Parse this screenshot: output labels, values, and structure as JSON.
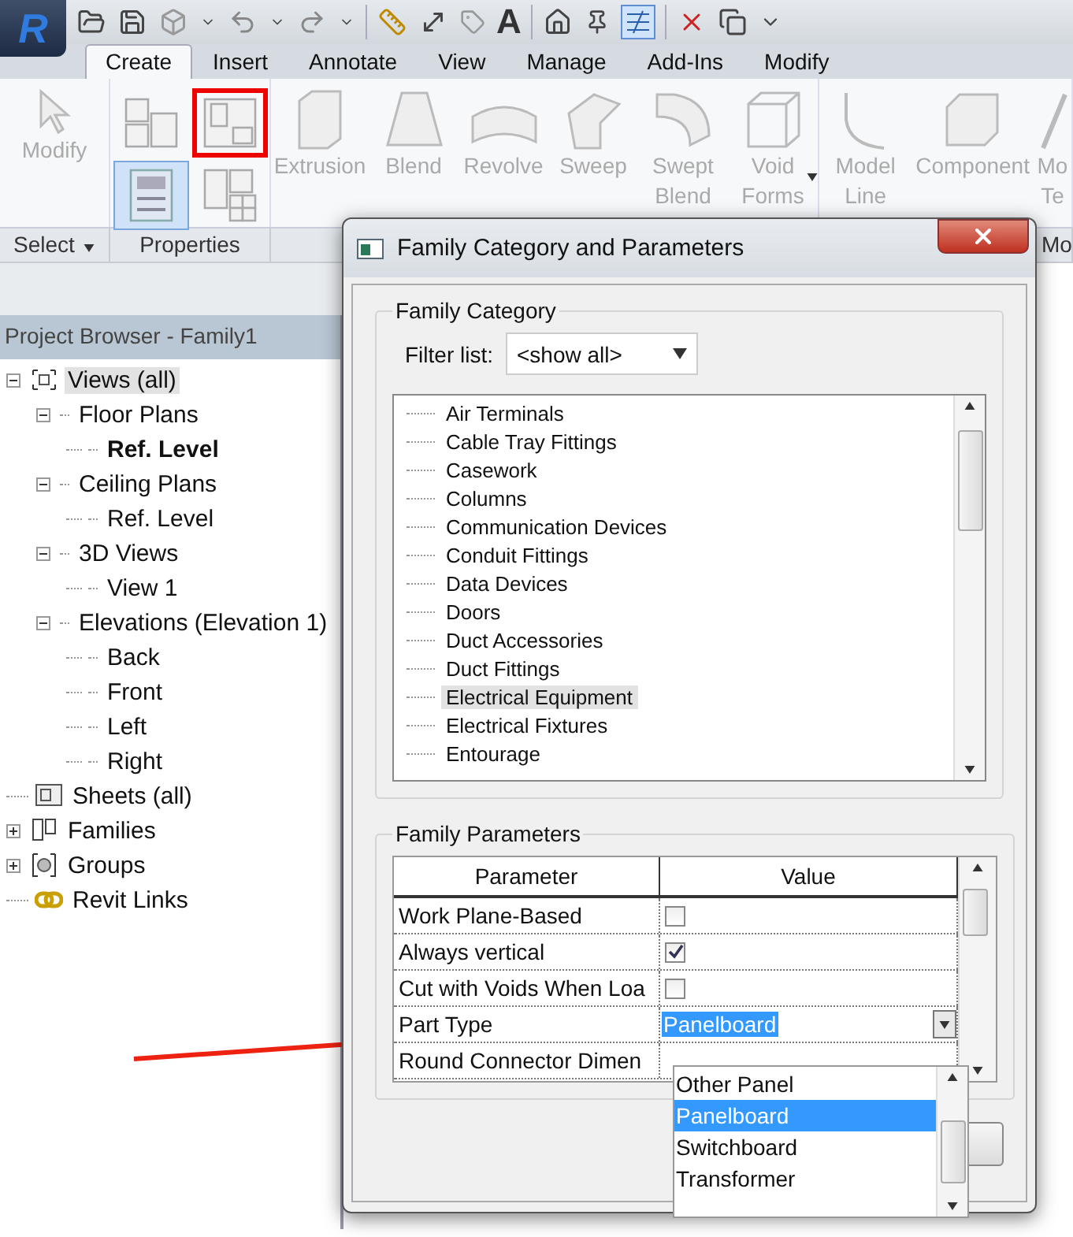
{
  "app_button": {
    "label": "R"
  },
  "quick_access": {
    "text_tool": "A"
  },
  "ribbon_tabs": [
    {
      "label": "Create",
      "selected": true
    },
    {
      "label": "Insert",
      "selected": false
    },
    {
      "label": "Annotate",
      "selected": false
    },
    {
      "label": "View",
      "selected": false
    },
    {
      "label": "Manage",
      "selected": false
    },
    {
      "label": "Add-Ins",
      "selected": false
    },
    {
      "label": "Modify",
      "selected": false
    }
  ],
  "ribbon_panels": [
    {
      "title": "Select",
      "dropdown": true,
      "items": [
        {
          "kind": "cursor",
          "lines": [
            "Modify"
          ]
        }
      ]
    },
    {
      "title": "Properties",
      "small_buttons": [
        {
          "kind": "types",
          "selected": false,
          "annotated": false
        },
        {
          "kind": "category",
          "selected": false,
          "annotated": true
        },
        {
          "kind": "properties",
          "selected": true,
          "annotated": false
        },
        {
          "kind": "grid",
          "selected": false,
          "annotated": false
        }
      ]
    },
    {
      "items": [
        {
          "kind": "extrusion",
          "lines": [
            "Extrusion"
          ]
        },
        {
          "kind": "blend",
          "lines": [
            "Blend"
          ]
        },
        {
          "kind": "revolve",
          "lines": [
            "Revolve"
          ]
        },
        {
          "kind": "sweep",
          "lines": [
            "Sweep"
          ]
        },
        {
          "kind": "swept",
          "lines": [
            "Swept",
            "Blend"
          ]
        },
        {
          "kind": "void",
          "lines": [
            "Void",
            "Forms"
          ],
          "dropdown": true
        }
      ]
    },
    {
      "title": "Mo",
      "items": [
        {
          "kind": "line",
          "lines": [
            "Model",
            "Line"
          ]
        },
        {
          "kind": "component",
          "lines": [
            "Component"
          ]
        },
        {
          "kind": "text",
          "lines": [
            "Mo",
            "Te"
          ]
        }
      ]
    }
  ],
  "project_browser": {
    "title": "Project Browser - Family1",
    "tree": [
      {
        "label": "Views (all)",
        "kind": "views",
        "expanded": true,
        "selected": true,
        "children": [
          {
            "label": "Floor Plans",
            "expanded": true,
            "selected": false,
            "children": [
              {
                "label": "Ref. Level",
                "active": true,
                "selected": false
              }
            ]
          },
          {
            "label": "Ceiling Plans",
            "expanded": true,
            "selected": false,
            "children": [
              {
                "label": "Ref. Level",
                "active": false,
                "selected": false
              }
            ]
          },
          {
            "label": "3D Views",
            "expanded": true,
            "selected": false,
            "children": [
              {
                "label": "View 1",
                "active": false,
                "selected": false
              }
            ]
          },
          {
            "label": "Elevations (Elevation 1)",
            "expanded": true,
            "selected": false,
            "children": [
              {
                "label": "Back",
                "active": false,
                "selected": false
              },
              {
                "label": "Front",
                "active": false,
                "selected": false
              },
              {
                "label": "Left",
                "active": false,
                "selected": false
              },
              {
                "label": "Right",
                "active": false,
                "selected": false
              }
            ]
          }
        ]
      },
      {
        "label": "Sheets (all)",
        "kind": "sheets",
        "selected": false
      },
      {
        "label": "Families",
        "kind": "families",
        "expanded": false,
        "selected": false
      },
      {
        "label": "Groups",
        "kind": "groups",
        "expanded": false,
        "selected": false
      },
      {
        "label": "Revit Links",
        "kind": "links",
        "selected": false
      }
    ]
  },
  "dialog": {
    "title": "Family Category and Parameters",
    "category_group": {
      "legend": "Family Category",
      "filter_label": "Filter list:",
      "filter_value": "<show all>",
      "categories": [
        {
          "label": "Air Terminals",
          "selected": false
        },
        {
          "label": "Cable Tray Fittings",
          "selected": false
        },
        {
          "label": "Casework",
          "selected": false
        },
        {
          "label": "Columns",
          "selected": false
        },
        {
          "label": "Communication Devices",
          "selected": false
        },
        {
          "label": "Conduit Fittings",
          "selected": false
        },
        {
          "label": "Data Devices",
          "selected": false
        },
        {
          "label": "Doors",
          "selected": false
        },
        {
          "label": "Duct Accessories",
          "selected": false
        },
        {
          "label": "Duct Fittings",
          "selected": false
        },
        {
          "label": "Electrical Equipment",
          "selected": true
        },
        {
          "label": "Electrical Fixtures",
          "selected": false
        },
        {
          "label": "Entourage",
          "selected": false
        }
      ]
    },
    "parameters_group": {
      "legend": "Family Parameters",
      "columns": [
        "Parameter",
        "Value"
      ],
      "rows": [
        {
          "name": "Work Plane-Based",
          "kind": "checkbox",
          "checked": false
        },
        {
          "name": "Always vertical",
          "kind": "checkbox",
          "checked": true
        },
        {
          "name": "Cut with Voids When Loa",
          "kind": "checkbox",
          "checked": false
        },
        {
          "name": "Part Type",
          "kind": "dropdown",
          "value": "Panelboard"
        },
        {
          "name": "Round Connector Dimen",
          "kind": "empty"
        }
      ],
      "dropdown_options": [
        {
          "label": "Other Panel",
          "selected": false
        },
        {
          "label": "Panelboard",
          "selected": true
        },
        {
          "label": "Switchboard",
          "selected": false
        },
        {
          "label": "Transformer",
          "selected": false
        }
      ]
    }
  }
}
